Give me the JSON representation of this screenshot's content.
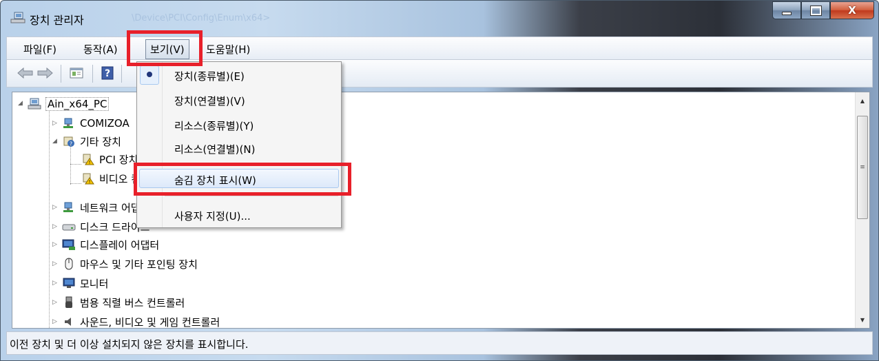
{
  "window": {
    "title": "장치 관리자",
    "ghost_title": "\\Device\\PCI\\Config\\Enum\\x64>",
    "controls": {
      "minimize": "—",
      "maximize": "□",
      "close": "X"
    }
  },
  "menubar": {
    "items": [
      {
        "label": "파일(F)"
      },
      {
        "label": "동작(A)"
      },
      {
        "label": "보기(V)"
      },
      {
        "label": "도움말(H)"
      }
    ]
  },
  "toolbar": {
    "icons": [
      "back-arrow-icon",
      "forward-arrow-icon",
      "properties-icon",
      "help-icon"
    ]
  },
  "tree": {
    "root": "Ain_x64_PC",
    "rows": [
      {
        "label": "COMIZOA",
        "icon": "network-device-icon"
      },
      {
        "label": "기타 장치",
        "icon": "unknown-device-icon"
      },
      {
        "label": "PCI 장치",
        "icon": "warning-device-icon"
      },
      {
        "label": "비디오 컨트롤러",
        "icon": "warning-device-icon"
      },
      {
        "label": "네트워크 어댑터",
        "icon": "network-adapter-icon"
      },
      {
        "label": "디스크 드라이브",
        "icon": "disk-drive-icon"
      },
      {
        "label": "디스플레이 어댑터",
        "icon": "display-adapter-icon"
      },
      {
        "label": "마우스 및 기타 포인팅 장치",
        "icon": "mouse-icon"
      },
      {
        "label": "모니터",
        "icon": "monitor-icon"
      },
      {
        "label": "범용 직렬 버스 컨트롤러",
        "icon": "usb-icon"
      },
      {
        "label": "사운드, 비디오 및 게임 컨트롤러",
        "icon": "sound-icon"
      }
    ]
  },
  "view_menu": {
    "items": [
      {
        "label": "장치(종류별)(E)",
        "selected": true
      },
      {
        "label": "장치(연결별)(V)",
        "selected": false
      },
      {
        "label": "리소스(종류별)(Y)",
        "selected": false
      },
      {
        "label": "리소스(연결별)(N)",
        "selected": false
      },
      {
        "label": "숨김 장치 표시(W)",
        "selected": false
      },
      {
        "label": "사용자 지정(U)...",
        "selected": false
      }
    ]
  },
  "statusbar": {
    "text": "이전 장치 및 더 이상 설치되지 않은 장치를 표시합니다."
  },
  "colors": {
    "highlight_red": "#e8202a",
    "menu_hover_border": "#a8c8ef",
    "radio_dot": "#21367a"
  }
}
